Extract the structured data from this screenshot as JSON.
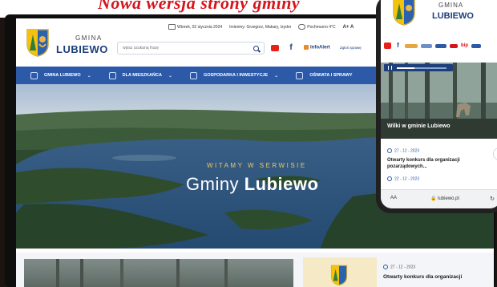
{
  "headline": "Nowa wersja strony gminy",
  "desktop": {
    "brand": {
      "gmina": "GMINA",
      "name": "LUBIEWO"
    },
    "infobar": {
      "date": "Wtorek, 02 stycznia 2024",
      "nameday": "Imieniny: Grzegorz, Makary, Izydor",
      "weather": "Pochmurno 4°C",
      "font_size": "A+ A"
    },
    "search": {
      "placeholder": "wpisz szukaną frazę"
    },
    "infoalert": "InfoAlert",
    "report": "Zgłoś sprawę",
    "nav": [
      {
        "label": "GMINA LUBIEWO",
        "chevron": "⌄"
      },
      {
        "label": "DLA MIESZKAŃCA",
        "chevron": "⌄"
      },
      {
        "label": "GOSPODARKA I INWESTYCJE",
        "chevron": "⌄"
      },
      {
        "label": "OŚWIATA I SPRAWY",
        "chevron": ""
      }
    ],
    "hero": {
      "small": "WITAMY W SERWISIE",
      "big_prefix": "Gminy ",
      "big_bold": "Lubiewo"
    },
    "news": {
      "date": "27 - 12 - 2023",
      "title": "Otwarty konkurs dla organizacji"
    }
  },
  "phone": {
    "brand": {
      "gmina": "GMINA",
      "name": "LUBIEWO"
    },
    "bip": "bip",
    "caption": "Wilki w gminie Lubiewo",
    "news": [
      {
        "date": "27 - 12 - 2023",
        "title": "Otwarty konkurs dla organizacji pozarządowych..."
      },
      {
        "date": "22 - 12 - 2023"
      }
    ],
    "browser": {
      "aa": "AA",
      "domain": "lubiewo.pl",
      "reload": "↻"
    }
  },
  "colors": {
    "brand_blue": "#2d5aa8",
    "headline_red": "#d6141b",
    "accent_gold": "#f1c95b"
  }
}
